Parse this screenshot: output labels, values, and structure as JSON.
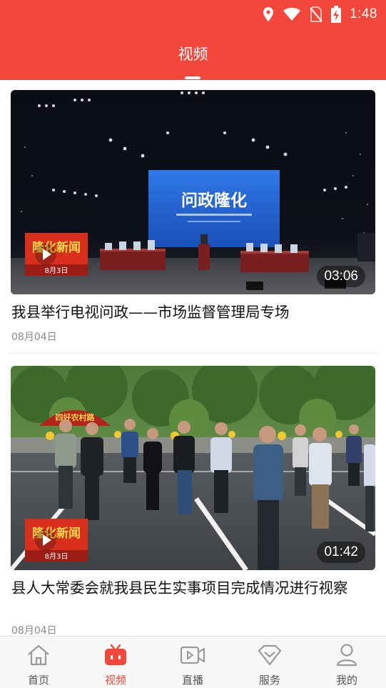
{
  "status_bar": {
    "time": "1:48",
    "icons": [
      "location-icon",
      "wifi-icon",
      "no-sim-icon",
      "battery-charging-icon"
    ]
  },
  "header": {
    "title": "视频"
  },
  "colors": {
    "brand_red": "#f2473a",
    "tab_inactive": "#9a9a9a"
  },
  "videos": [
    {
      "screen_title": "问政隆化",
      "badge_text": "隆化新闻",
      "badge_sub": "8月3日",
      "duration": "03:06",
      "title": "我县举行电视问政——市场监督管理局专场",
      "date": "08月04日"
    },
    {
      "banner_text": "四好农村路",
      "badge_text": "隆化新闻",
      "badge_sub": "8月3日",
      "duration": "01:42",
      "title": "县人大常委会就我县民生实事项目完成情况进行视察",
      "date": "08月04日"
    }
  ],
  "tabs": [
    {
      "label": "首页",
      "icon": "home-icon",
      "active": false
    },
    {
      "label": "视频",
      "icon": "tv-icon",
      "active": true
    },
    {
      "label": "直播",
      "icon": "live-video-icon",
      "active": false
    },
    {
      "label": "服务",
      "icon": "diamond-icon",
      "active": false
    },
    {
      "label": "我的",
      "icon": "user-icon",
      "active": false
    }
  ]
}
